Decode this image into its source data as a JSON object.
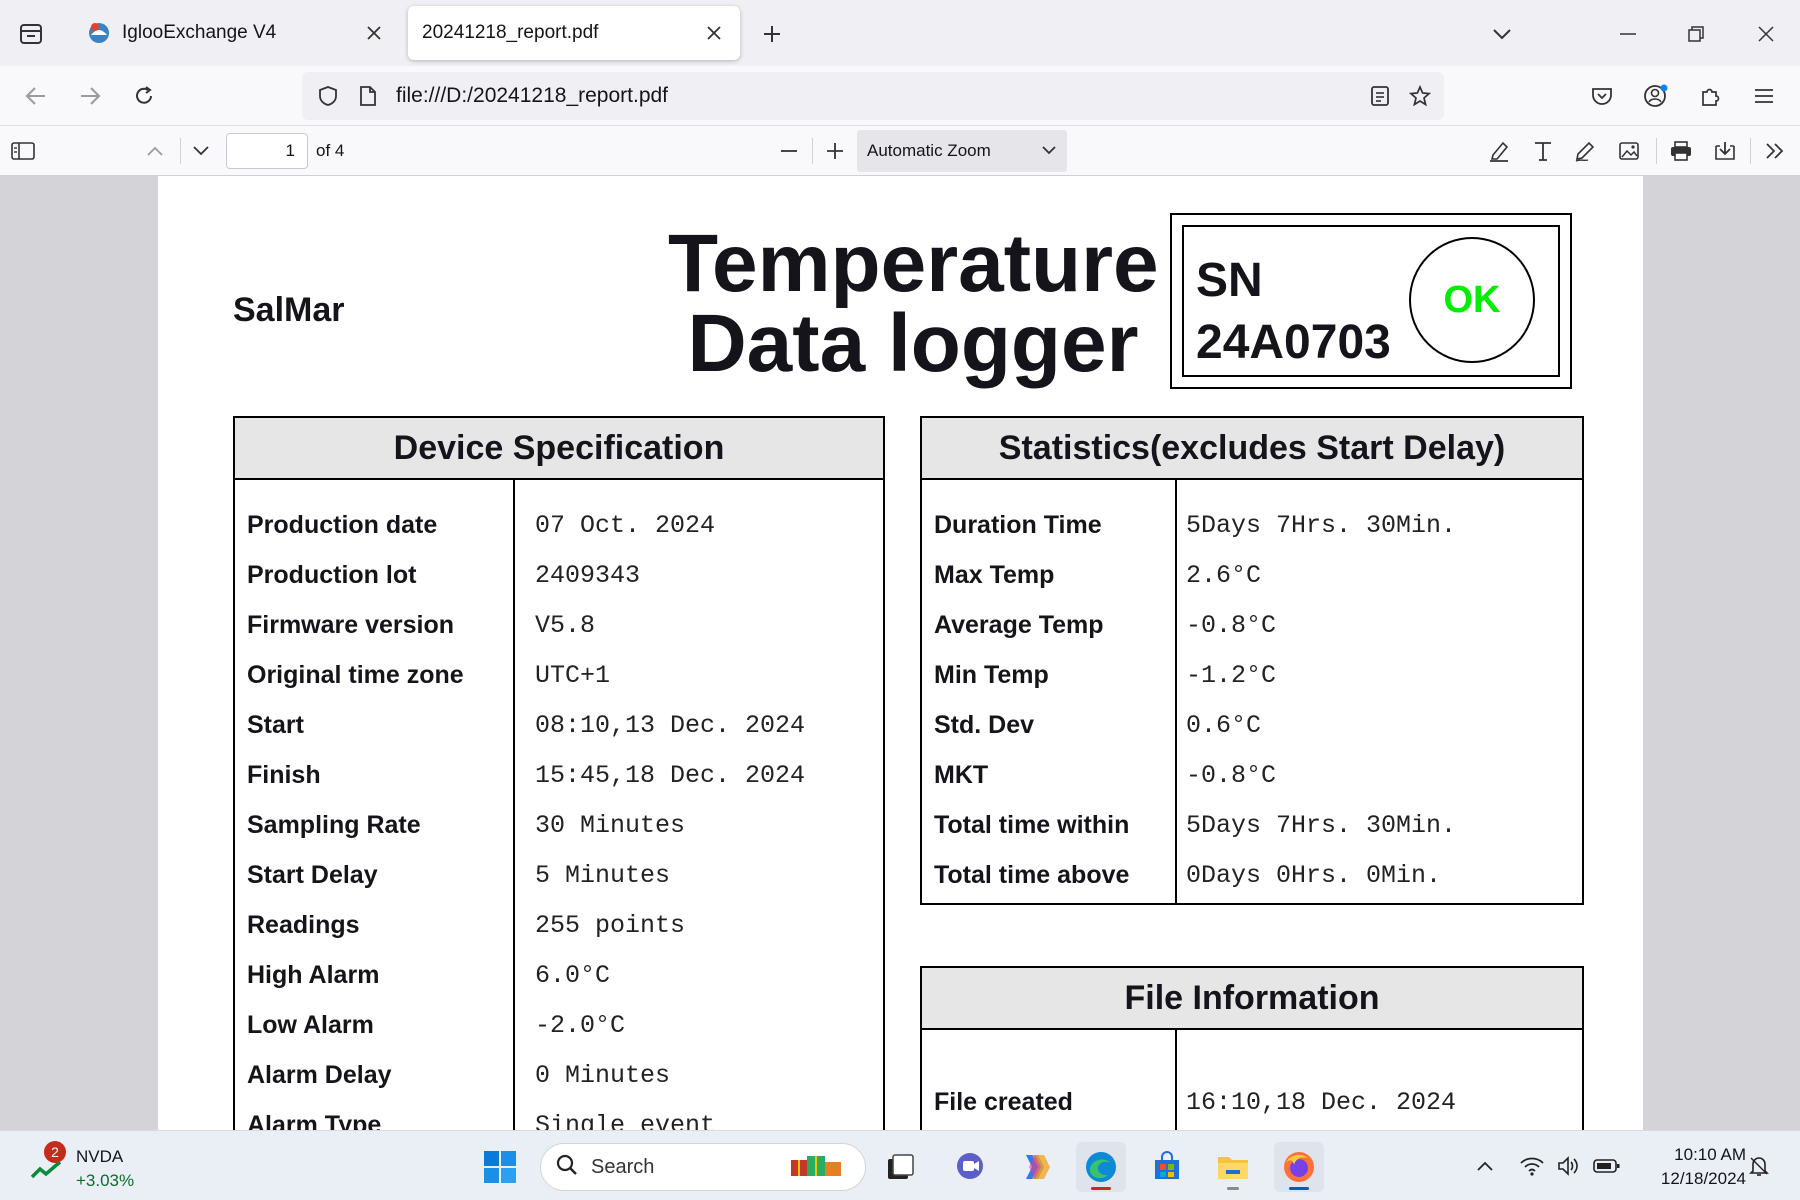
{
  "browser": {
    "tabs": [
      {
        "title": "IglooExchange V4",
        "active": false
      },
      {
        "title": "20241218_report.pdf",
        "active": true
      }
    ],
    "url": "file:///D:/20241218_report.pdf"
  },
  "pdf_toolbar": {
    "page_number": "1",
    "page_count_label": "of 4",
    "zoom": "Automatic Zoom"
  },
  "report": {
    "company": "SalMar",
    "title_line1": "Temperature",
    "title_line2": "Data logger",
    "sn_label": "SN",
    "sn_value": "24A0703",
    "status": "OK",
    "status_color": "#00ee00",
    "device_spec": {
      "heading": "Device Specification",
      "rows": [
        {
          "label": "Production date",
          "value": "07 Oct. 2024"
        },
        {
          "label": "Production lot",
          "value": "2409343"
        },
        {
          "label": "Firmware version",
          "value": "V5.8"
        },
        {
          "label": "Original time zone",
          "value": "UTC+1"
        },
        {
          "label": "Start",
          "value": "08:10,13 Dec. 2024"
        },
        {
          "label": "Finish",
          "value": "15:45,18 Dec. 2024"
        },
        {
          "label": "Sampling Rate",
          "value": "30 Minutes"
        },
        {
          "label": "Start Delay",
          "value": "5 Minutes"
        },
        {
          "label": "Readings",
          "value": "255 points"
        },
        {
          "label": "High Alarm",
          "value": "6.0°C"
        },
        {
          "label": "Low Alarm",
          "value": "-2.0°C"
        },
        {
          "label": "Alarm Delay",
          "value": "0 Minutes"
        },
        {
          "label": "Alarm Type",
          "value": "Single event"
        }
      ]
    },
    "statistics": {
      "heading": "Statistics(excludes Start Delay)",
      "rows": [
        {
          "label": "Duration Time",
          "value": "5Days 7Hrs. 30Min."
        },
        {
          "label": "Max Temp",
          "value": "2.6°C"
        },
        {
          "label": "Average Temp",
          "value": "-0.8°C"
        },
        {
          "label": "Min Temp",
          "value": "-1.2°C"
        },
        {
          "label": "Std. Dev",
          "value": "0.6°C"
        },
        {
          "label": "MKT",
          "value": "-0.8°C"
        },
        {
          "label": "Total time within",
          "value": "5Days 7Hrs. 30Min."
        },
        {
          "label": "Total time above",
          "value": "0Days 0Hrs. 0Min."
        }
      ]
    },
    "file_info": {
      "heading": "File Information",
      "rows": [
        {
          "label": "File created",
          "value": "16:10,18 Dec. 2024"
        }
      ]
    }
  },
  "taskbar": {
    "stock_badge": "2",
    "stock_name": "NVDA",
    "stock_change": "+3.03%",
    "search_label": "Search",
    "time": "10:10 AM",
    "date": "12/18/2024"
  },
  "icons": {
    "accent": "#005fb8",
    "firefox": "firefox-icon",
    "edge": "edge-icon"
  }
}
